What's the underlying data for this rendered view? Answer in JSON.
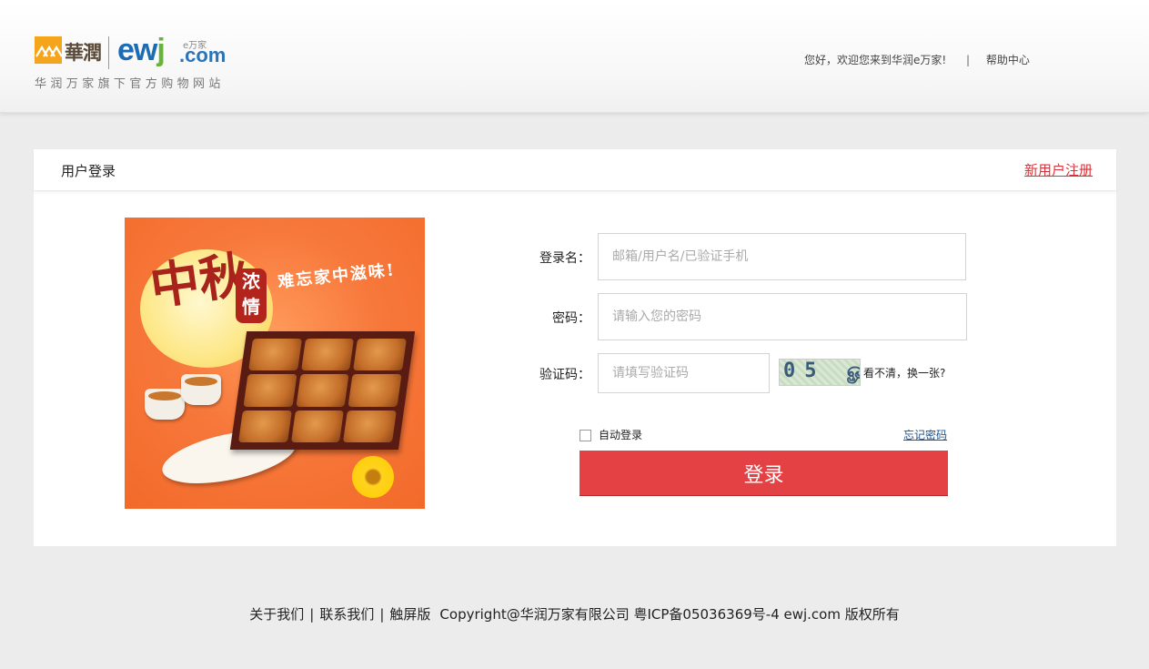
{
  "header": {
    "logo": {
      "huarun": "華潤",
      "ewj": "ew",
      "ewj_j": "j",
      "com": ".com",
      "mini": "e万家",
      "tagline": "华润万家旗下官方购物网站"
    },
    "welcome": "您好，欢迎您来到华润e万家!",
    "separator": "|",
    "help_link": "帮助中心"
  },
  "panel": {
    "title": "用户登录",
    "register_link": "新用户注册"
  },
  "banner": {
    "calligraphy": "中秋",
    "seal_top": "浓",
    "seal_bottom": "情",
    "slogan": "难忘家中滋味!"
  },
  "form": {
    "username": {
      "label": "登录名：",
      "placeholder": "邮箱/用户名/已验证手机",
      "value": ""
    },
    "password": {
      "label": "密码：",
      "placeholder": "请输入您的密码",
      "value": ""
    },
    "captcha": {
      "label": "验证码：",
      "placeholder": "请填写验证码",
      "value": "",
      "image_text": "05 ௐ",
      "refresh_text": "看不清，换一张?"
    },
    "auto_login": {
      "label": "自动登录",
      "checked": false
    },
    "forgot_password": "忘记密码",
    "submit_label": "登录"
  },
  "footer": {
    "about": "关于我们",
    "contact": "联系我们",
    "touch": "触屏版",
    "separator": "|",
    "copyright": "Copyright@华润万家有限公司 粤ICP备05036369号-4 ewj.com 版权所有"
  },
  "colors": {
    "accent": "#e44145",
    "register_link": "#d8333a",
    "link_blue": "#1c4f8a",
    "background": "#ececec"
  }
}
